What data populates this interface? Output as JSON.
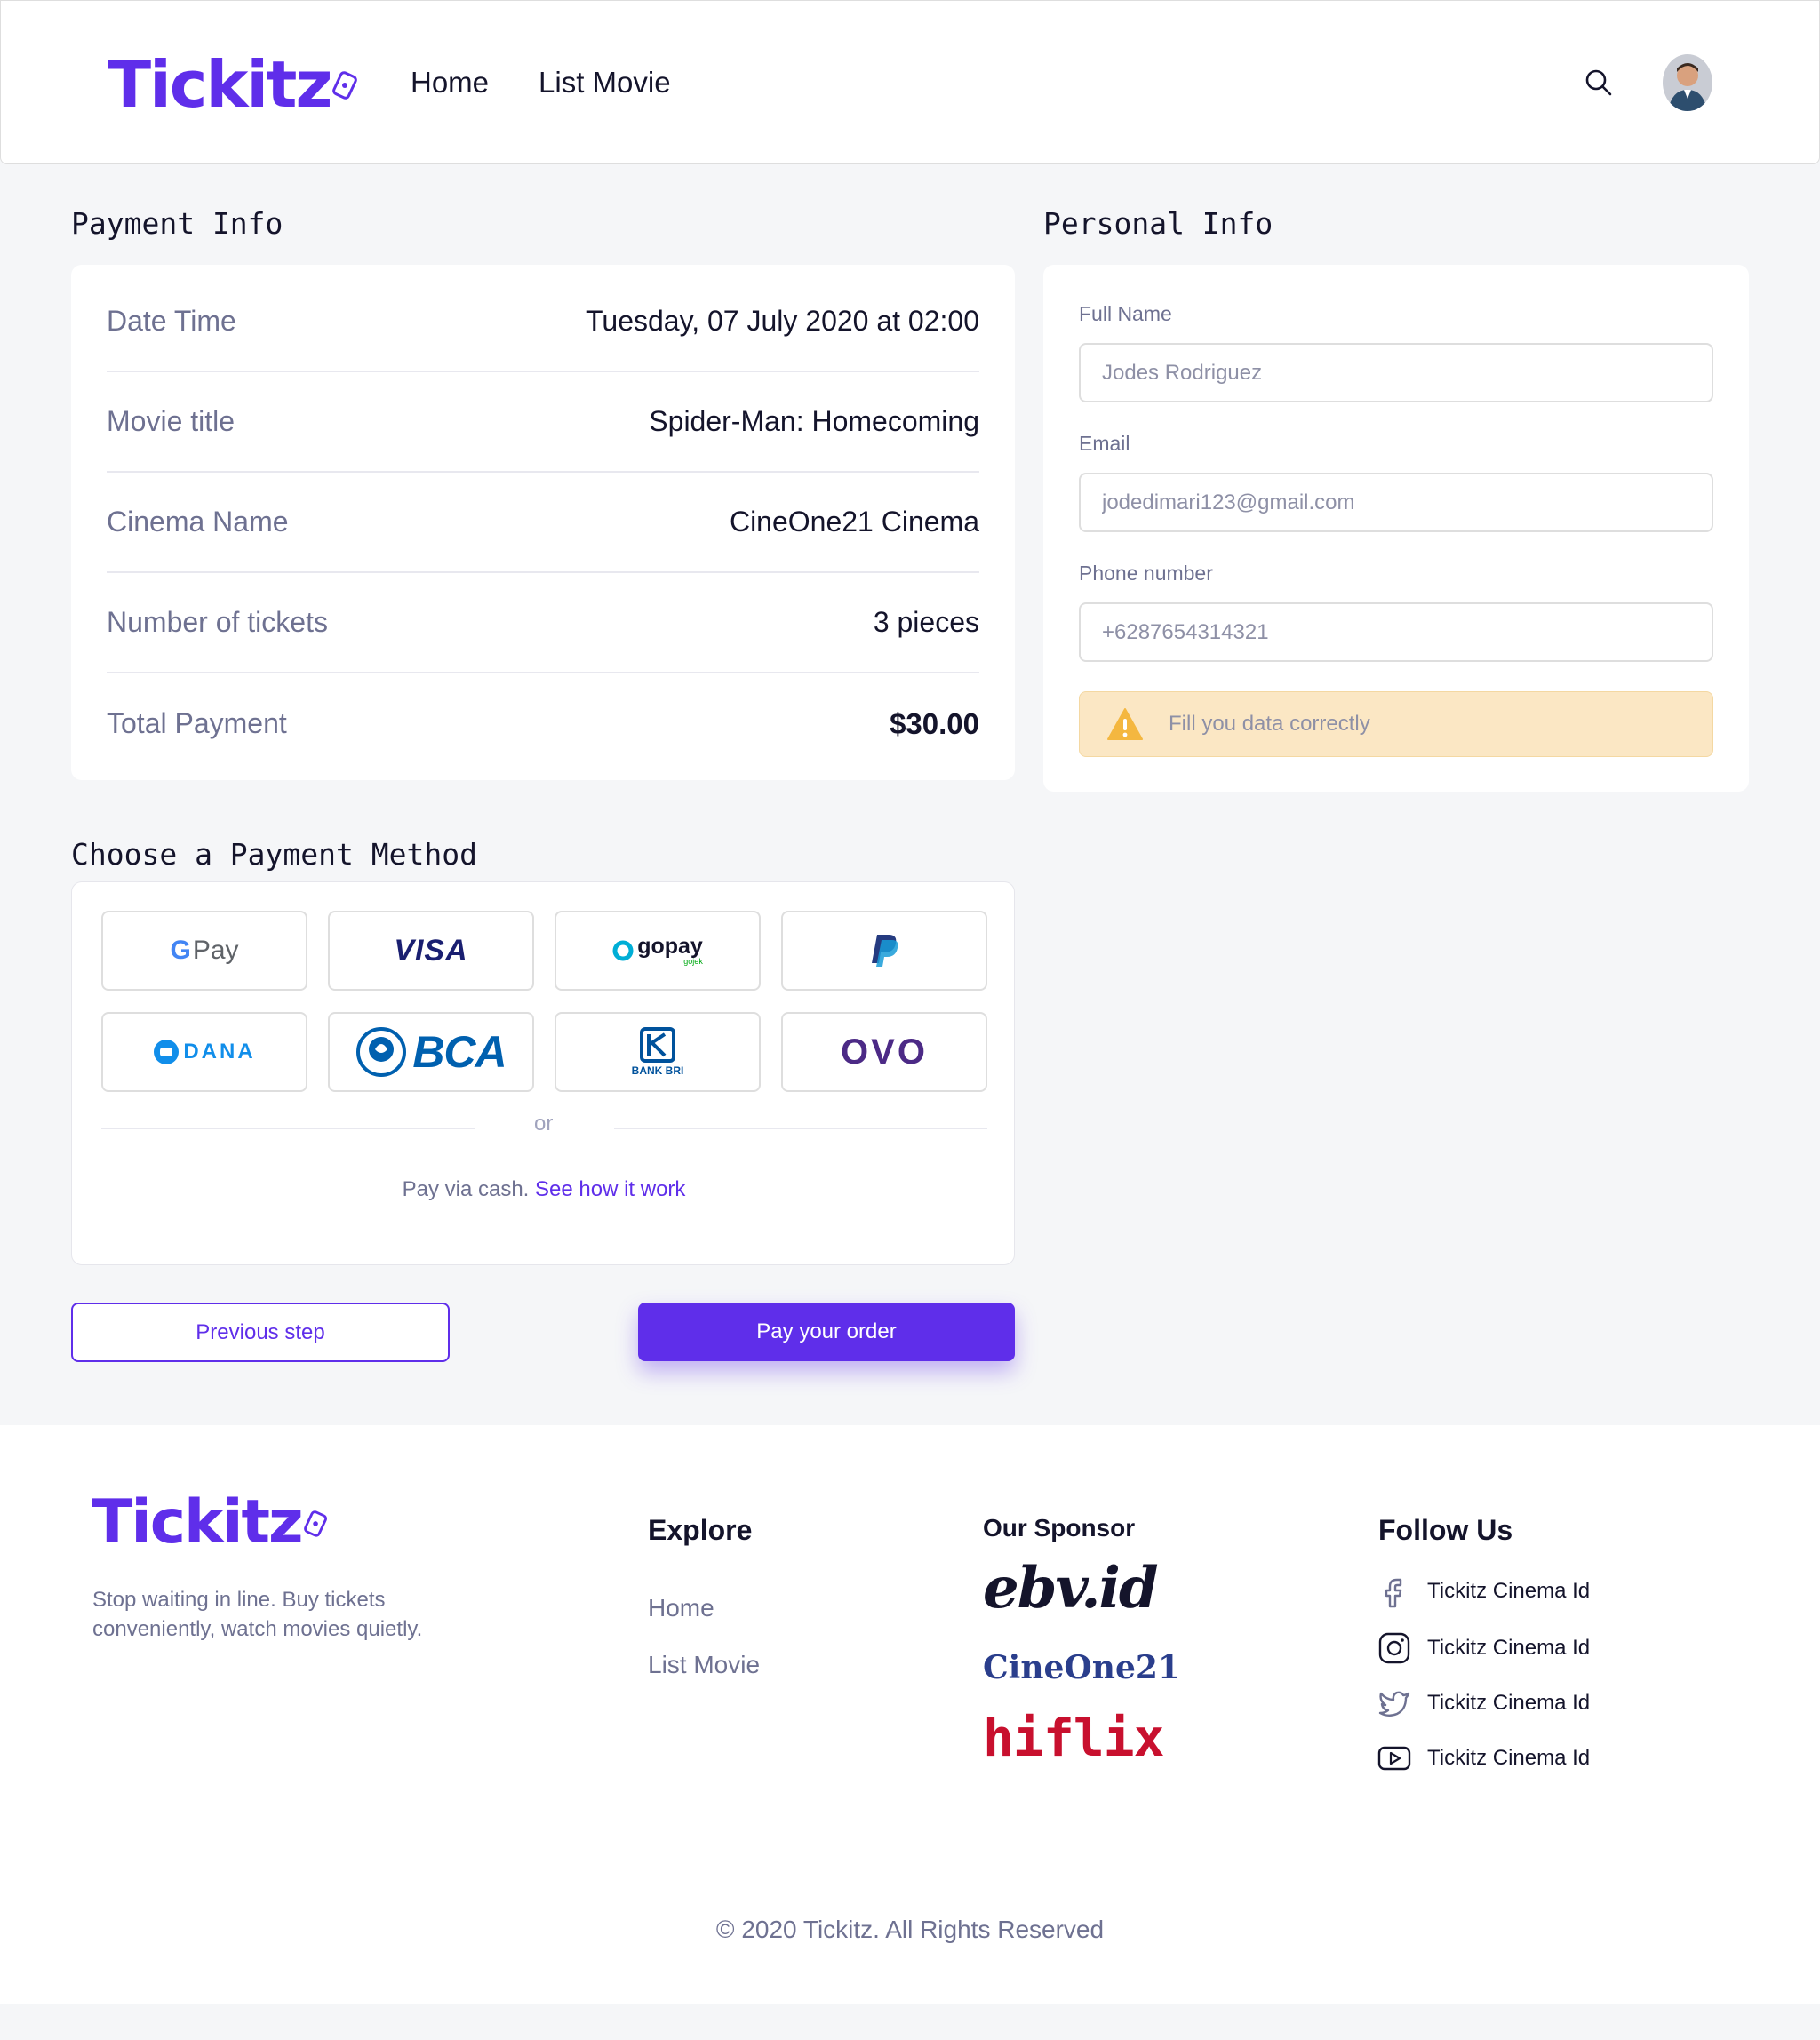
{
  "brand": {
    "name": "Tickitz",
    "color": "#5F2EEA"
  },
  "nav": {
    "items": [
      "Home",
      "List Movie"
    ]
  },
  "header": {
    "search_icon": "search-icon",
    "avatar_icon": "user-avatar"
  },
  "payment_info": {
    "title": "Payment Info",
    "rows": [
      {
        "label": "Date Time",
        "value": "Tuesday, 07 July 2020 at 02:00"
      },
      {
        "label": "Movie title",
        "value": "Spider-Man: Homecoming"
      },
      {
        "label": "Cinema Name",
        "value": "CineOne21 Cinema"
      },
      {
        "label": "Number of tickets",
        "value": "3 pieces"
      },
      {
        "label": "Total Payment",
        "value": "$30.00"
      }
    ]
  },
  "personal_info": {
    "title": "Personal Info",
    "full_name": {
      "label": "Full Name",
      "value": "Jodes Rodriguez"
    },
    "email": {
      "label": "Email",
      "value": "jodedimari123@gmail.com"
    },
    "phone": {
      "label": "Phone number",
      "value": "+6287654314321"
    },
    "warning": {
      "icon": "warning-icon",
      "text": "Fill you data correctly",
      "color": "#FBE7C4"
    }
  },
  "payment_method": {
    "title": "Choose a Payment Method",
    "methods": [
      {
        "id": "gpay",
        "text_g": "G",
        "text_pay": "Pay"
      },
      {
        "id": "visa",
        "text": "VISA"
      },
      {
        "id": "gopay",
        "text": "gopay",
        "subtext": "gojek"
      },
      {
        "id": "paypal",
        "text": "P"
      },
      {
        "id": "dana",
        "text": "DANA"
      },
      {
        "id": "bca",
        "text": "BCA"
      },
      {
        "id": "bri",
        "text": "BANK BRI"
      },
      {
        "id": "ovo",
        "text": "OVO"
      }
    ],
    "or": "or",
    "cash_text": "Pay via cash.",
    "cash_link": "See how it work"
  },
  "actions": {
    "previous": "Previous step",
    "pay": "Pay your order"
  },
  "footer": {
    "tagline": "Stop waiting in line. Buy tickets conveniently, watch movies quietly.",
    "explore": {
      "heading": "Explore",
      "links": [
        "Home",
        "List Movie"
      ]
    },
    "sponsor": {
      "heading": "Our Sponsor",
      "sponsors": [
        "ebv.id",
        "CineOne21",
        "hiflix"
      ]
    },
    "follow": {
      "heading": "Follow Us",
      "items": [
        {
          "icon": "facebook-icon",
          "label": "Tickitz Cinema Id"
        },
        {
          "icon": "instagram-icon",
          "label": "Tickitz Cinema Id"
        },
        {
          "icon": "twitter-icon",
          "label": "Tickitz Cinema Id"
        },
        {
          "icon": "youtube-icon",
          "label": "Tickitz Cinema Id"
        }
      ]
    },
    "copyright": "© 2020 Tickitz. All Rights Reserved"
  }
}
